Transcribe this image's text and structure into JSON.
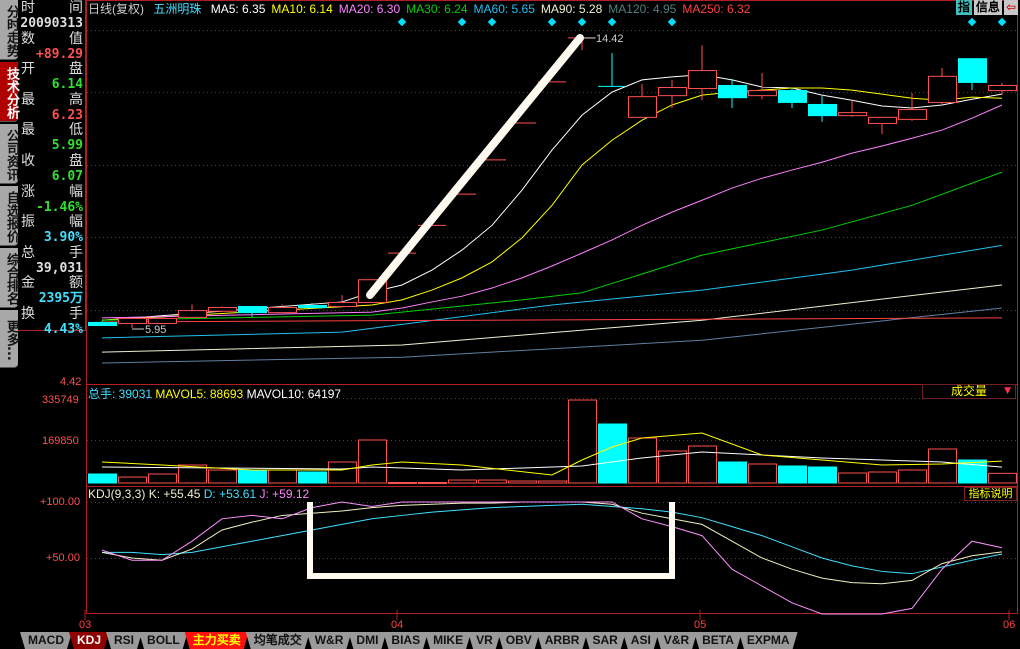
{
  "left_tabs": [
    {
      "label": "分时走势",
      "active": false
    },
    {
      "label": "技术分析",
      "active": true
    },
    {
      "label": "公司资讯",
      "active": false
    },
    {
      "label": "自选报价",
      "active": false
    },
    {
      "label": "综合排名",
      "active": false
    },
    {
      "label": "更多...",
      "active": false
    }
  ],
  "info_panel": {
    "rows": [
      {
        "l": "时",
        "r": "间",
        "value": "20090313",
        "color": "#e0e0e0"
      },
      {
        "l": "数",
        "r": "值",
        "value": "+89.29",
        "color": "#ff5050"
      },
      {
        "l": "开",
        "r": "盘",
        "value": "6.14",
        "color": "#30e030"
      },
      {
        "l": "最",
        "r": "高",
        "value": "6.23",
        "color": "#ff5050"
      },
      {
        "l": "最",
        "r": "低",
        "value": "5.99",
        "color": "#30e030"
      },
      {
        "l": "收",
        "r": "盘",
        "value": "6.07",
        "color": "#30e030"
      },
      {
        "l": "涨",
        "r": "幅",
        "value": "-1.46%",
        "color": "#30e030"
      },
      {
        "l": "振",
        "r": "幅",
        "value": "3.90%",
        "color": "#40e0ff"
      },
      {
        "l": "总",
        "r": "手",
        "value": "39,031",
        "color": "#e0e0e0"
      },
      {
        "l": "金",
        "r": "额",
        "value": "2395万",
        "color": "#40e0ff"
      },
      {
        "l": "换",
        "r": "手",
        "value": "4.43%",
        "color": "#40e0ff"
      }
    ]
  },
  "header": {
    "period": "日线(复权)",
    "stock_name": "五洲明珠",
    "ma": [
      {
        "label": "MA5: 6.35",
        "color": "#ffffff"
      },
      {
        "label": "MA10: 6.14",
        "color": "#ffff00"
      },
      {
        "label": "MA20: 6.30",
        "color": "#ff80ff"
      },
      {
        "label": "MA30: 6.24",
        "color": "#00d000"
      },
      {
        "label": "MA60: 5.65",
        "color": "#20c0f0"
      },
      {
        "label": "MA90: 5.28",
        "color": "#f0f0d0"
      },
      {
        "label": "MA120: 4.95",
        "color": "#508080"
      },
      {
        "label": "MA250: 6.32",
        "color": "#ff4040"
      }
    ],
    "buttons": {
      "indicator": "指",
      "info": "信息",
      "exit": "exit-icon"
    }
  },
  "chart_data": {
    "type": "candlestick",
    "price_axis": {
      "min_label": "4.42"
    },
    "x_ticks": [
      {
        "index": -0.5,
        "label": "03"
      },
      {
        "index": 9.9,
        "label": "04"
      },
      {
        "index": 20,
        "label": "05"
      },
      {
        "index": 30.3,
        "label": "06"
      }
    ],
    "annotations": {
      "high_label": "14.42",
      "low_label": "5.95"
    },
    "signal_marks": [
      10,
      12,
      13,
      15,
      16,
      17,
      19,
      29,
      30
    ],
    "candles": [
      [
        6.04,
        6.07,
        5.95,
        5.95
      ],
      [
        6.01,
        6.16,
        5.86,
        6.16
      ],
      [
        6.01,
        6.16,
        6.01,
        6.16
      ],
      [
        6.19,
        6.56,
        6.19,
        6.39
      ],
      [
        6.37,
        6.5,
        6.37,
        6.48
      ],
      [
        6.51,
        6.51,
        6.19,
        6.33
      ],
      [
        6.33,
        6.56,
        6.33,
        6.48
      ],
      [
        6.54,
        6.6,
        6.42,
        6.48
      ],
      [
        6.51,
        6.83,
        6.51,
        6.63
      ],
      [
        6.63,
        7.3,
        6.63,
        7.3
      ],
      [
        8.07,
        8.07,
        8.07,
        8.07
      ],
      [
        8.89,
        8.89,
        8.89,
        8.89
      ],
      [
        9.81,
        9.81,
        9.81,
        9.81
      ],
      [
        10.82,
        10.82,
        10.82,
        10.82
      ],
      [
        11.91,
        11.91,
        11.91,
        11.91
      ],
      [
        13.12,
        13.12,
        13.12,
        13.12
      ],
      [
        14.42,
        14.42,
        14.06,
        14.42
      ],
      [
        13.0,
        13.97,
        12.99,
        12.99
      ],
      [
        12.09,
        13.06,
        12.09,
        12.7
      ],
      [
        12.73,
        13.18,
        12.35,
        12.97
      ],
      [
        12.94,
        14.2,
        12.58,
        13.47
      ],
      [
        13.03,
        13.21,
        12.35,
        12.67
      ],
      [
        12.73,
        13.38,
        12.61,
        12.88
      ],
      [
        12.88,
        12.94,
        12.35,
        12.53
      ],
      [
        12.47,
        12.7,
        11.94,
        12.14
      ],
      [
        12.14,
        12.56,
        12.09,
        12.23
      ],
      [
        11.91,
        12.09,
        11.58,
        12.09
      ],
      [
        12.03,
        12.79,
        11.97,
        12.32
      ],
      [
        12.53,
        13.53,
        12.47,
        13.3
      ],
      [
        13.82,
        13.82,
        12.88,
        13.12
      ],
      [
        12.88,
        13.09,
        12.73,
        13.03
      ]
    ],
    "ma_series": [
      {
        "name": "MA5",
        "color": "#ffffff",
        "points": [
          [
            0,
            6.09
          ],
          [
            8,
            6.63
          ],
          [
            9,
            6.92
          ],
          [
            10,
            7.13
          ],
          [
            11,
            7.57
          ],
          [
            12,
            8.16
          ],
          [
            13,
            8.89
          ],
          [
            14,
            9.93
          ],
          [
            15,
            11.11
          ],
          [
            16,
            12.14
          ],
          [
            17,
            12.82
          ],
          [
            18,
            13.18
          ],
          [
            19,
            13.27
          ],
          [
            20,
            13.33
          ],
          [
            21,
            13.18
          ],
          [
            22,
            12.97
          ],
          [
            23,
            12.94
          ],
          [
            24,
            12.73
          ],
          [
            25,
            12.58
          ],
          [
            26,
            12.41
          ],
          [
            27,
            12.35
          ],
          [
            28,
            12.44
          ],
          [
            29,
            12.61
          ],
          [
            30,
            12.76
          ]
        ]
      },
      {
        "name": "MA10",
        "color": "#ffff00",
        "points": [
          [
            0,
            6.09
          ],
          [
            9,
            6.54
          ],
          [
            10,
            6.69
          ],
          [
            11,
            6.98
          ],
          [
            12,
            7.34
          ],
          [
            13,
            7.81
          ],
          [
            14,
            8.52
          ],
          [
            15,
            9.48
          ],
          [
            16,
            10.67
          ],
          [
            17,
            11.4
          ],
          [
            18,
            11.99
          ],
          [
            19,
            12.44
          ],
          [
            20,
            12.73
          ],
          [
            21,
            12.82
          ],
          [
            22,
            12.88
          ],
          [
            23,
            12.94
          ],
          [
            24,
            12.94
          ],
          [
            25,
            12.88
          ],
          [
            26,
            12.76
          ],
          [
            27,
            12.64
          ],
          [
            28,
            12.58
          ],
          [
            29,
            12.67
          ],
          [
            30,
            12.64
          ]
        ]
      },
      {
        "name": "MA20",
        "color": "#ff80ff",
        "points": [
          [
            0,
            6.16
          ],
          [
            9,
            6.33
          ],
          [
            10,
            6.45
          ],
          [
            11,
            6.63
          ],
          [
            12,
            6.8
          ],
          [
            13,
            7.04
          ],
          [
            14,
            7.34
          ],
          [
            15,
            7.69
          ],
          [
            16,
            8.07
          ],
          [
            17,
            8.46
          ],
          [
            18,
            8.89
          ],
          [
            19,
            9.28
          ],
          [
            20,
            9.63
          ],
          [
            21,
            9.99
          ],
          [
            22,
            10.28
          ],
          [
            23,
            10.52
          ],
          [
            24,
            10.75
          ],
          [
            25,
            11.02
          ],
          [
            26,
            11.23
          ],
          [
            27,
            11.46
          ],
          [
            28,
            11.7
          ],
          [
            29,
            12.05
          ],
          [
            30,
            12.44
          ]
        ]
      },
      {
        "name": "MA30",
        "color": "#00d000",
        "points": [
          [
            0,
            6.09
          ],
          [
            9,
            6.24
          ],
          [
            14,
            6.69
          ],
          [
            16,
            6.9
          ],
          [
            20,
            8.01
          ],
          [
            24,
            8.75
          ],
          [
            27,
            9.48
          ],
          [
            30,
            10.46
          ]
        ]
      },
      {
        "name": "MA60",
        "color": "#20c0f0",
        "points": [
          [
            0,
            5.57
          ],
          [
            8,
            5.74
          ],
          [
            15,
            6.54
          ],
          [
            20,
            6.98
          ],
          [
            25,
            7.57
          ],
          [
            30,
            8.3
          ]
        ]
      },
      {
        "name": "MA90",
        "color": "#f0f0d0",
        "points": [
          [
            0,
            5.15
          ],
          [
            10,
            5.36
          ],
          [
            20,
            6.09
          ],
          [
            30,
            7.13
          ]
        ]
      },
      {
        "name": "MA120",
        "color": "#6080a0",
        "points": [
          [
            0,
            4.83
          ],
          [
            10,
            5.0
          ],
          [
            20,
            5.5
          ],
          [
            30,
            6.45
          ]
        ]
      },
      {
        "name": "MA250",
        "color": "#ff4040",
        "points": [
          [
            0,
            6.04
          ],
          [
            30,
            6.16
          ]
        ]
      }
    ],
    "volume": {
      "header": {
        "total_label": "总手: 39031",
        "mavol5_label": "MAVOL5: 88693",
        "mavol10_label": "MAVOL10: 64197"
      },
      "selector": "成交量",
      "axis_labels": [
        "335749",
        "169850"
      ],
      "values": [
        36400,
        24000,
        36400,
        72800,
        52600,
        52600,
        52600,
        44500,
        85000,
        174000,
        2000,
        2000,
        12000,
        12000,
        8000,
        8000,
        335749,
        238700,
        182000,
        129500,
        149700,
        85000,
        76900,
        68800,
        64700,
        40500,
        44500,
        52600,
        137600,
        93000,
        39031
      ],
      "mavol5": [
        [
          0,
          85000
        ],
        [
          2,
          72800
        ],
        [
          5,
          52600
        ],
        [
          8,
          52600
        ],
        [
          9,
          72800
        ],
        [
          10,
          85000
        ],
        [
          12,
          72800
        ],
        [
          15,
          32400
        ],
        [
          16,
          93000
        ],
        [
          17,
          145700
        ],
        [
          18,
          182000
        ],
        [
          20,
          202300
        ],
        [
          22,
          113300
        ],
        [
          24,
          93000
        ],
        [
          26,
          72800
        ],
        [
          28,
          76900
        ],
        [
          30,
          88693
        ]
      ],
      "mavol10": [
        [
          0,
          64700
        ],
        [
          8,
          56600
        ],
        [
          9,
          64700
        ],
        [
          12,
          52600
        ],
        [
          16,
          68800
        ],
        [
          18,
          101200
        ],
        [
          20,
          125400
        ],
        [
          24,
          101200
        ],
        [
          28,
          85000
        ],
        [
          30,
          64197
        ]
      ]
    },
    "kdj": {
      "header": {
        "name": "KDJ(9,3,3)",
        "k_label": "K: +55.45",
        "d_label": "D: +53.61",
        "j_label": "J: +59.12"
      },
      "help": "指标说明",
      "axis_labels": [
        "+100.00",
        "+50.00"
      ],
      "K": [
        55,
        50,
        48,
        58,
        75,
        82,
        88,
        90,
        92,
        95,
        97,
        98,
        99,
        99,
        100,
        100,
        100,
        98,
        90,
        85,
        80,
        65,
        50,
        40,
        32,
        28,
        27,
        30,
        45,
        52,
        55.45
      ],
      "D": [
        55,
        55,
        53,
        55,
        60,
        65,
        70,
        75,
        80,
        85,
        88,
        91,
        93,
        95,
        96,
        97,
        98,
        96,
        94,
        91,
        86,
        78,
        70,
        60,
        50,
        43,
        38,
        36,
        42,
        48,
        53.61
      ],
      "J": [
        57,
        48,
        48,
        65,
        85,
        88,
        85,
        95,
        100,
        96,
        100,
        100,
        100,
        100,
        100,
        100,
        100,
        100,
        85,
        78,
        70,
        40,
        25,
        10,
        0,
        0,
        0,
        5,
        40,
        65,
        59.12
      ]
    }
  },
  "bottom_tabs": [
    {
      "label": "MACD",
      "style": ""
    },
    {
      "label": "KDJ",
      "style": "active"
    },
    {
      "label": "RSI",
      "style": ""
    },
    {
      "label": "BOLL",
      "style": ""
    },
    {
      "label": "主力买卖",
      "style": "hot"
    },
    {
      "label": "均笔成交",
      "style": ""
    },
    {
      "label": "W&R",
      "style": ""
    },
    {
      "label": "DMI",
      "style": ""
    },
    {
      "label": "BIAS",
      "style": ""
    },
    {
      "label": "MIKE",
      "style": ""
    },
    {
      "label": "VR",
      "style": ""
    },
    {
      "label": "OBV",
      "style": ""
    },
    {
      "label": "ARBR",
      "style": ""
    },
    {
      "label": "SAR",
      "style": ""
    },
    {
      "label": "ASI",
      "style": ""
    },
    {
      "label": "V&R",
      "style": ""
    },
    {
      "label": "BETA",
      "style": ""
    },
    {
      "label": "EXPMA",
      "style": ""
    }
  ]
}
